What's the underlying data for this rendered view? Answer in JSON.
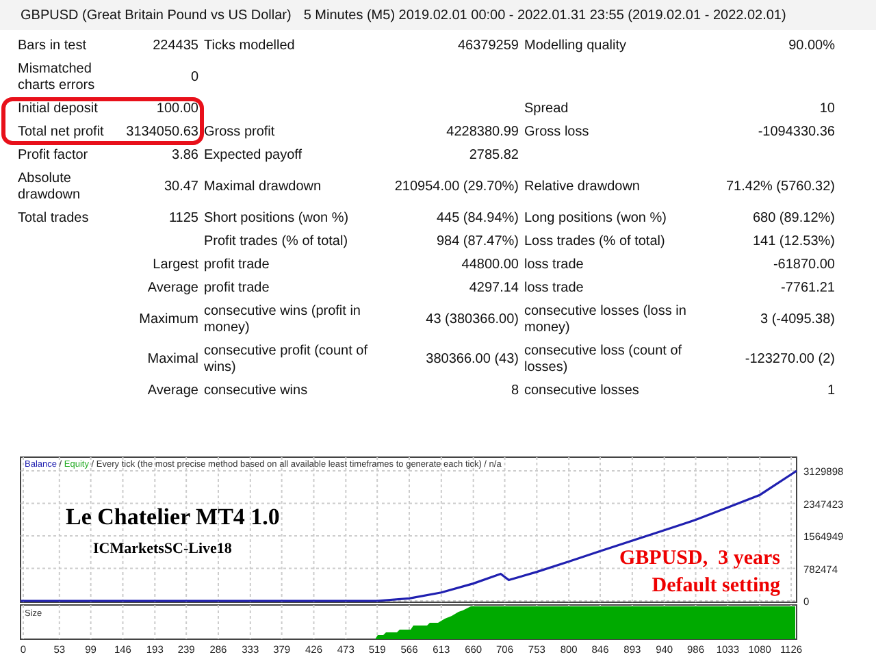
{
  "header": {
    "title": "GBPUSD (Great Britain Pound vs US Dollar)",
    "period": "5 Minutes (M5) 2019.02.01 00:00 - 2022.01.31 23:55 (2019.02.01 - 2022.02.01)"
  },
  "report": {
    "rows": [
      {
        "highlighted": false,
        "cells": [
          "Bars in test",
          "224435",
          "Ticks modelled",
          "46379259",
          "Modelling quality",
          "90.00%"
        ]
      },
      {
        "highlighted": false,
        "cells": [
          "Mismatched charts errors",
          "0",
          null,
          null,
          null,
          null
        ]
      },
      {
        "highlighted": true,
        "cells": [
          "Initial deposit",
          "100.00",
          null,
          null,
          "Spread",
          "10"
        ]
      },
      {
        "highlighted": true,
        "cells": [
          "Total net profit",
          "3134050.63",
          "Gross profit",
          "4228380.99",
          "Gross loss",
          "-1094330.36"
        ]
      },
      {
        "highlighted": false,
        "cells": [
          "Profit factor",
          "3.86",
          "Expected payoff",
          "2785.82",
          null,
          null
        ]
      },
      {
        "highlighted": false,
        "cells": [
          "Absolute drawdown",
          "30.47",
          "Maximal drawdown",
          "210954.00 (29.70%)",
          "Relative drawdown",
          "71.42% (5760.32)"
        ]
      },
      {
        "highlighted": false,
        "cells": [
          "Total trades",
          "1125",
          "Short positions (won %)",
          "445 (84.94%)",
          "Long positions (won %)",
          "680 (89.12%)"
        ]
      },
      {
        "highlighted": false,
        "cells": [
          null,
          null,
          "Profit trades (% of total)",
          "984 (87.47%)",
          "Loss trades (% of total)",
          "141 (12.53%)"
        ]
      },
      {
        "highlighted": false,
        "cells": [
          null,
          "Largest",
          "profit trade",
          "44800.00",
          "loss trade",
          "-61870.00"
        ]
      },
      {
        "highlighted": false,
        "cells": [
          null,
          "Average",
          "profit trade",
          "4297.14",
          "loss trade",
          "-7761.21"
        ]
      },
      {
        "highlighted": false,
        "cells": [
          null,
          "Maximum",
          "consecutive wins (profit in money)",
          "43 (380366.00)",
          "consecutive losses (loss in money)",
          "3 (-4095.38)"
        ]
      },
      {
        "highlighted": false,
        "cells": [
          null,
          "Maximal",
          "consecutive profit (count of wins)",
          "380366.00 (43)",
          "consecutive loss (count of losses)",
          "-123270.00 (2)"
        ]
      },
      {
        "highlighted": false,
        "cells": [
          null,
          "Average",
          "consecutive wins",
          "8",
          "consecutive losses",
          "1"
        ]
      }
    ]
  },
  "chart": {
    "legend": {
      "separator": "/",
      "items": [
        {
          "text": "Equity",
          "color": "#22aa22"
        },
        {
          "text": "Every tick (the most precise method based on all available least timeframes to generate each tick)",
          "color": "#333333"
        },
        {
          "text": "n/a",
          "color": "#333333"
        }
      ]
    },
    "chart_data": {
      "type": "line",
      "grid": true,
      "xlim": [
        -4,
        1134
      ],
      "ylim": [
        -33000,
        3460000
      ],
      "x": [
        0,
        519,
        566,
        613,
        660,
        700,
        712,
        753,
        800,
        846,
        893,
        940,
        986,
        1033,
        1080,
        1134
      ],
      "series": [
        {
          "name": "Balance",
          "color": "#2020b0",
          "values": [
            0,
            0,
            60000,
            200000,
            420000,
            650000,
            500000,
            700000,
            950000,
            1200000,
            1450000,
            1700000,
            1950000,
            2250000,
            2550000,
            3130000
          ]
        }
      ],
      "xticks": [
        0,
        53,
        99,
        146,
        193,
        239,
        286,
        333,
        379,
        426,
        473,
        519,
        566,
        613,
        660,
        706,
        753,
        800,
        846,
        893,
        940,
        986,
        1033,
        1080,
        1126
      ],
      "yticks": [
        0,
        782474,
        1564949,
        2347423,
        3129898
      ]
    },
    "overlays": [
      {
        "kind": "title",
        "text": "Le Chatelier MT4 1.0"
      },
      {
        "kind": "subtitle",
        "text": "ICMarketsSC-Live18"
      },
      {
        "kind": "note",
        "text": "GBPUSD,  3 years"
      },
      {
        "kind": "note",
        "text": "Default setting"
      }
    ],
    "size_panel": {
      "label": "Size"
    }
  }
}
